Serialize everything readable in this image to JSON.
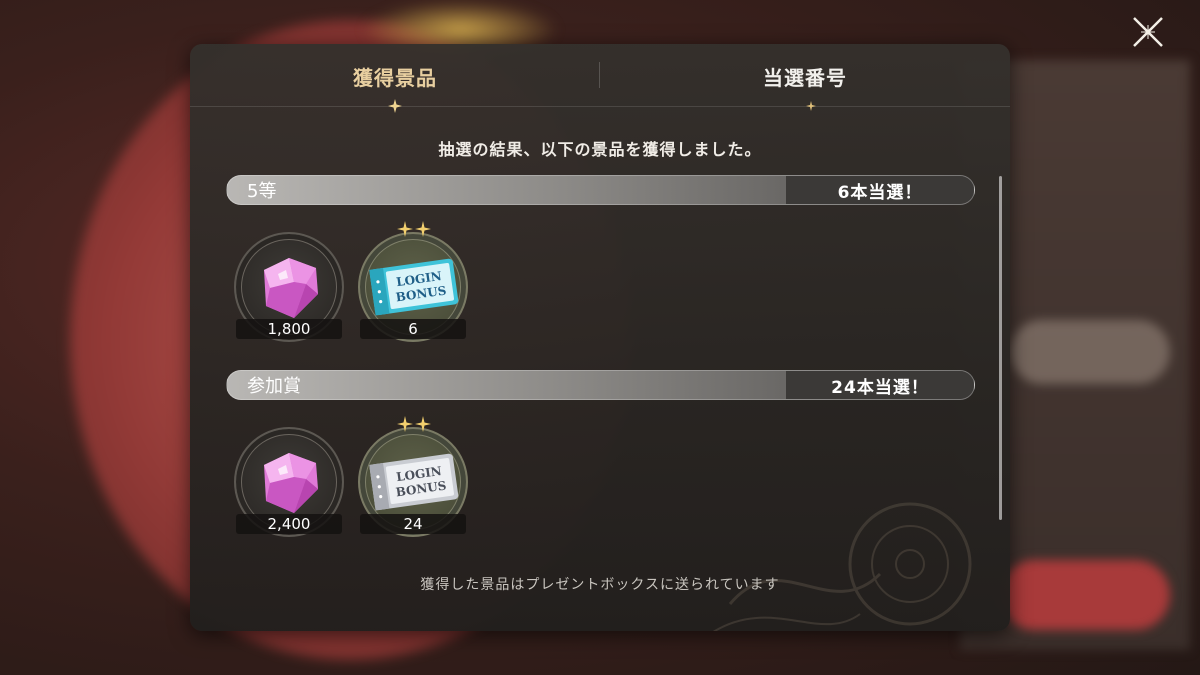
{
  "tabs": [
    {
      "label": "獲得景品",
      "active": true
    },
    {
      "label": "当選番号",
      "active": false
    }
  ],
  "result_message": "抽選の結果、以下の景品を獲得しました。",
  "tiers": [
    {
      "name": "5等",
      "count": "6本当選！",
      "items": [
        {
          "icon": "pink-gem-icon",
          "quantity": "1,800"
        },
        {
          "icon": "login-bonus-ticket-blue-icon",
          "quantity": "6",
          "ticket_text": [
            "LOGIN",
            "BONUS"
          ]
        }
      ]
    },
    {
      "name": "参加賞",
      "count": "24本当選！",
      "items": [
        {
          "icon": "pink-gem-icon",
          "quantity": "2,400"
        },
        {
          "icon": "login-bonus-ticket-silver-icon",
          "quantity": "24",
          "ticket_text": [
            "LOGIN",
            "BONUS"
          ]
        }
      ]
    }
  ],
  "footer_message": "獲得した景品はプレゼントボックスに送られています",
  "colors": {
    "active_tab": "#e8cfa0",
    "inactive_tab": "#f2f0ec",
    "gem": "#e07ad8",
    "ticket_blue": "#3fc3d9",
    "ticket_silver": "#c9ccd2",
    "gold_accent": "#d9b25a"
  },
  "icons": {
    "close": "close-cross-icon"
  }
}
